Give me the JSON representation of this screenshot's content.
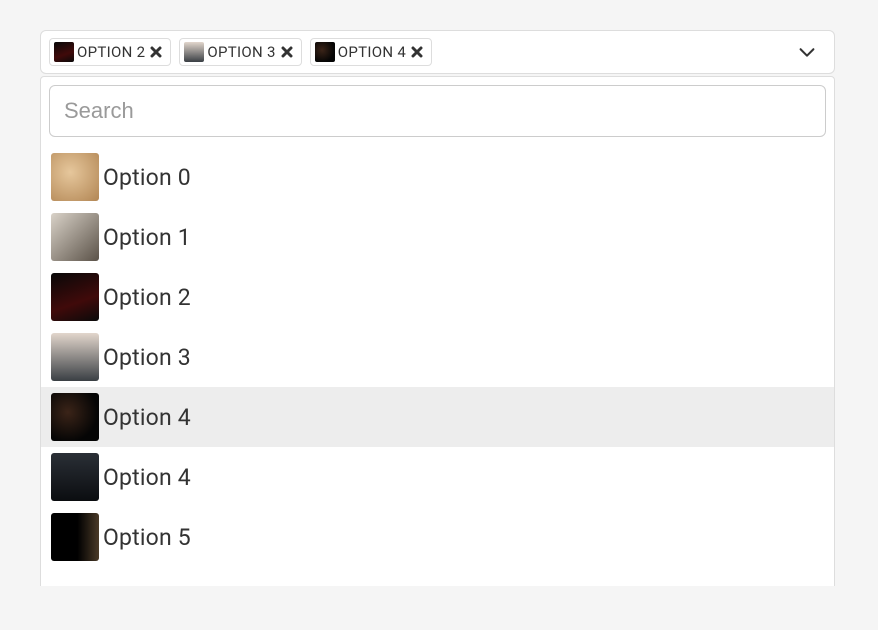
{
  "selected": [
    {
      "label": "OPTION 2",
      "thumb_class": "c2"
    },
    {
      "label": "OPTION 3",
      "thumb_class": "c3"
    },
    {
      "label": "OPTION 4",
      "thumb_class": "c4"
    }
  ],
  "search": {
    "placeholder": "Search",
    "value": ""
  },
  "options": [
    {
      "label": "Option 0",
      "thumb_class": "thumb-opt-0",
      "highlighted": false
    },
    {
      "label": "Option 1",
      "thumb_class": "thumb-opt-1",
      "highlighted": false
    },
    {
      "label": "Option 2",
      "thumb_class": "thumb-opt-2",
      "highlighted": false
    },
    {
      "label": "Option 3",
      "thumb_class": "thumb-opt-3",
      "highlighted": false
    },
    {
      "label": "Option 4",
      "thumb_class": "thumb-opt-4a",
      "highlighted": true
    },
    {
      "label": "Option 4",
      "thumb_class": "thumb-opt-4b",
      "highlighted": false
    },
    {
      "label": "Option 5",
      "thumb_class": "thumb-opt-5",
      "highlighted": false
    }
  ]
}
